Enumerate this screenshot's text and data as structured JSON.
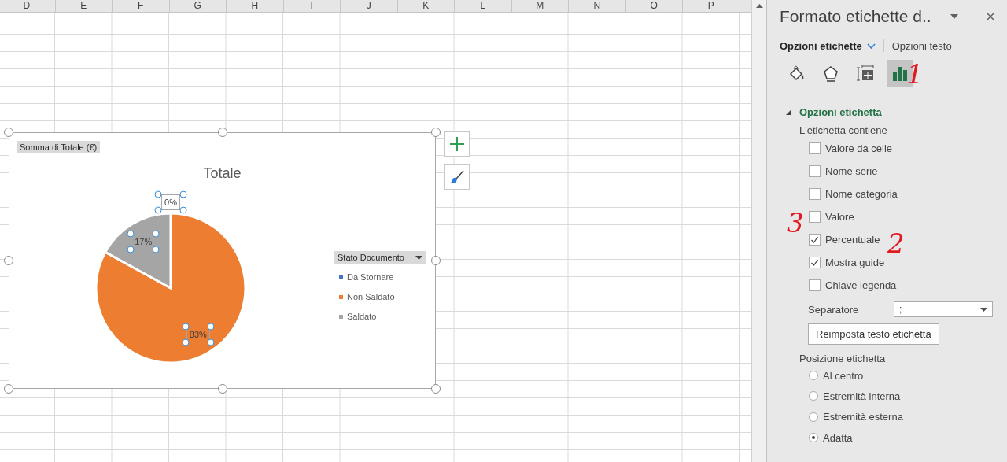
{
  "sheet": {
    "columns": [
      "D",
      "E",
      "F",
      "G",
      "H",
      "I",
      "J",
      "K",
      "L",
      "M",
      "N",
      "O",
      "P"
    ]
  },
  "chart": {
    "field_button": "Somma di Totale (€)",
    "legend_field": "Stato Documento",
    "labels_selected": true,
    "chart_data": {
      "type": "pie",
      "categories": [
        "Da Stornare",
        "Non Saldato",
        "Saldato"
      ],
      "series": [
        {
          "name": "Totale",
          "values": [
            0,
            83,
            17
          ],
          "colors": [
            "#4472c4",
            "#ed7d31",
            "#a5a5a5"
          ]
        }
      ],
      "value_labels": [
        "0%",
        "83%",
        "17%"
      ],
      "legend": "right"
    }
  },
  "panel": {
    "title": "Formato etichette d..",
    "tabs": [
      {
        "label": "Opzioni etichette",
        "selected": true
      },
      {
        "label": "Opzioni testo",
        "selected": false
      }
    ],
    "icons": [
      {
        "kind": "fill",
        "selected": false
      },
      {
        "kind": "effects",
        "selected": false
      },
      {
        "kind": "size",
        "selected": false
      },
      {
        "kind": "options",
        "selected": true
      }
    ],
    "section": {
      "title": "Opzioni etichetta",
      "expanded": true
    },
    "contains_label": "L'etichetta contiene",
    "checkboxes": [
      {
        "label": "Valore da celle",
        "checked": false
      },
      {
        "label": "Nome serie",
        "checked": false
      },
      {
        "label": "Nome categoria",
        "checked": false
      },
      {
        "label": "Valore",
        "checked": false
      },
      {
        "label": "Percentuale",
        "checked": true
      },
      {
        "label": "Mostra guide",
        "checked": true
      },
      {
        "label": "Chiave legenda",
        "checked": false
      }
    ],
    "separator": {
      "label": "Separatore",
      "value": ";"
    },
    "reset_button": "Reimposta testo etichetta",
    "position_label": "Posizione etichetta",
    "positions": [
      {
        "label": "Al centro",
        "selected": false
      },
      {
        "label": "Estremità interna",
        "selected": false
      },
      {
        "label": "Estremità esterna",
        "selected": false
      },
      {
        "label": "Adatta",
        "selected": true
      }
    ]
  },
  "annotations": [
    {
      "text": "1"
    },
    {
      "text": "2"
    },
    {
      "text": "3"
    }
  ]
}
